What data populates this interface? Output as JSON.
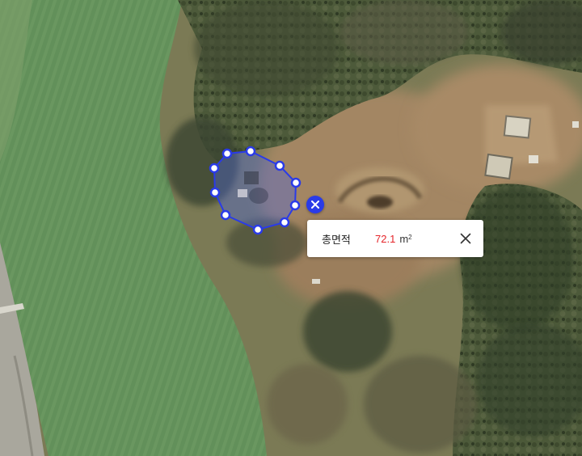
{
  "measurement": {
    "label": "총면적",
    "value": "72.1",
    "unit": "m",
    "unit_power": "2",
    "value_color": "#e5252a",
    "polygon_color": "#2a3be8",
    "close_icon": "close-icon",
    "delete_icon": "delete-measure-icon"
  }
}
